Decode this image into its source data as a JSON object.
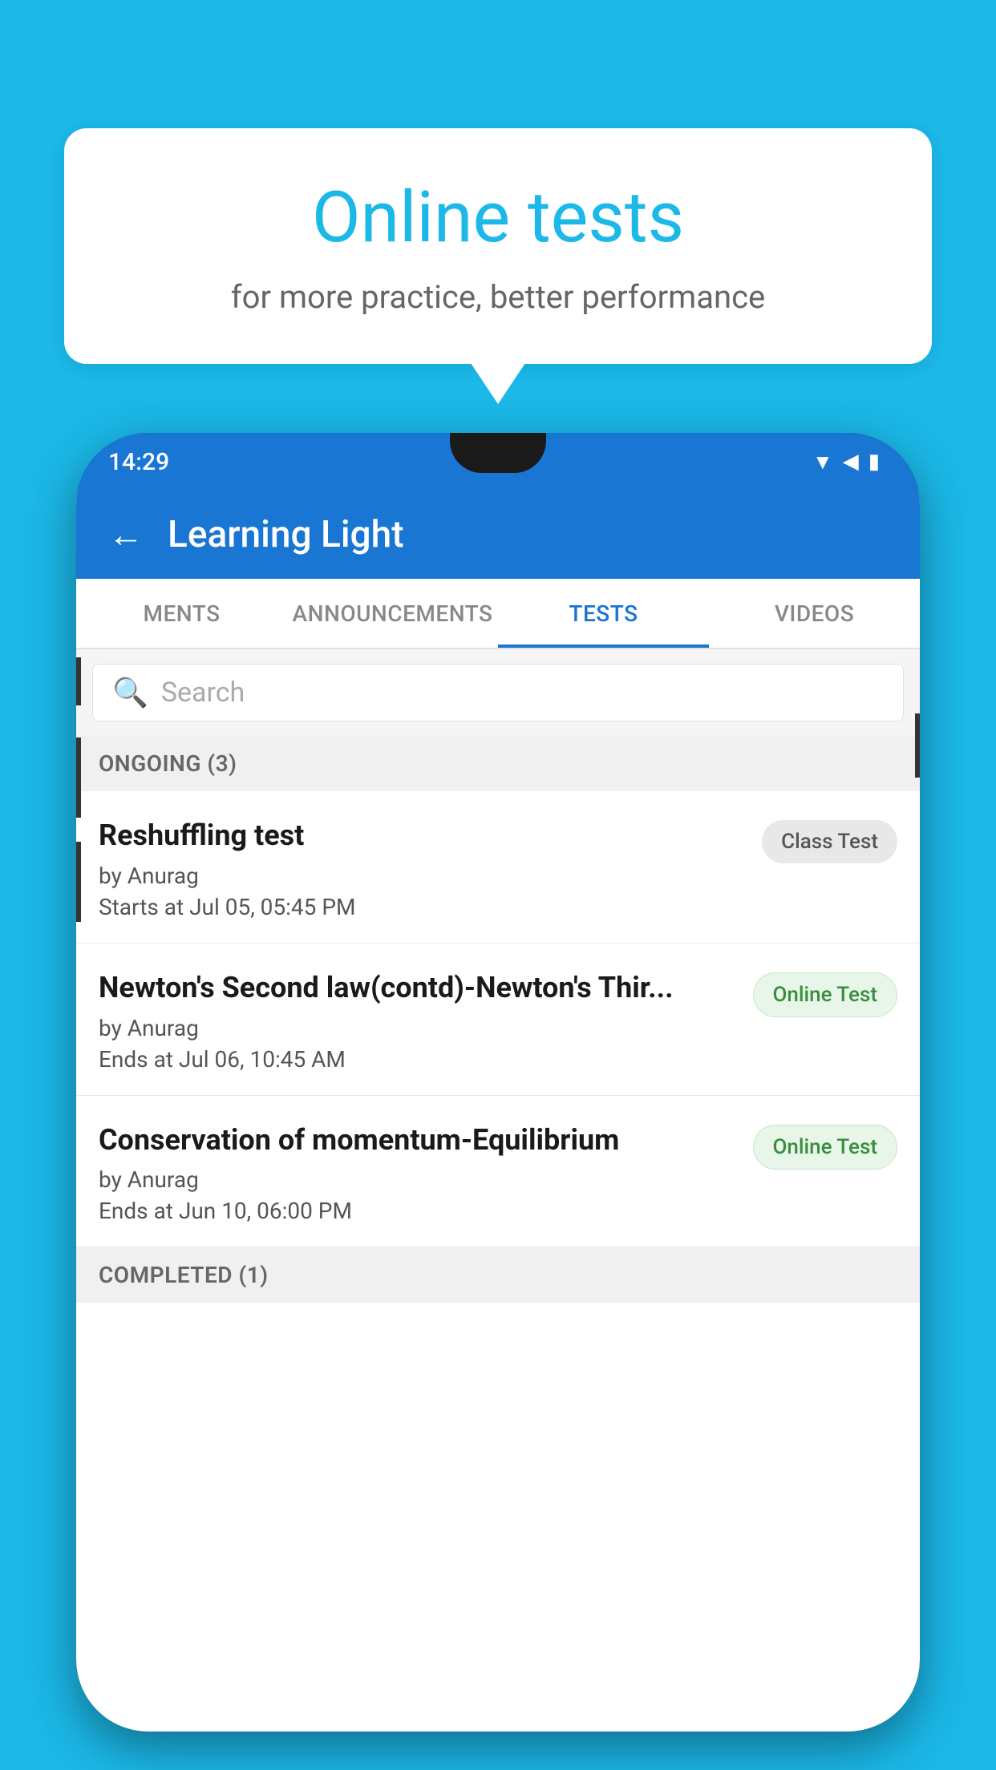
{
  "background": {
    "color": "#1bb8e8"
  },
  "speech_bubble": {
    "title": "Online tests",
    "subtitle": "for more practice, better performance"
  },
  "phone": {
    "status_bar": {
      "time": "14:29",
      "icons": [
        "wifi",
        "signal",
        "battery"
      ]
    },
    "app_bar": {
      "back_label": "←",
      "title": "Learning Light"
    },
    "tabs": [
      {
        "label": "MENTS",
        "active": false
      },
      {
        "label": "ANNOUNCEMENTS",
        "active": false
      },
      {
        "label": "TESTS",
        "active": true
      },
      {
        "label": "VIDEOS",
        "active": false
      }
    ],
    "search": {
      "placeholder": "Search",
      "icon": "🔍"
    },
    "sections": [
      {
        "header": "ONGOING (3)",
        "items": [
          {
            "name": "Reshuffling test",
            "author": "by Anurag",
            "date": "Starts at  Jul 05, 05:45 PM",
            "badge": "Class Test",
            "badge_type": "class"
          },
          {
            "name": "Newton's Second law(contd)-Newton's Thir...",
            "author": "by Anurag",
            "date": "Ends at  Jul 06, 10:45 AM",
            "badge": "Online Test",
            "badge_type": "online"
          },
          {
            "name": "Conservation of momentum-Equilibrium",
            "author": "by Anurag",
            "date": "Ends at  Jun 10, 06:00 PM",
            "badge": "Online Test",
            "badge_type": "online"
          }
        ]
      },
      {
        "header": "COMPLETED (1)",
        "items": []
      }
    ]
  }
}
